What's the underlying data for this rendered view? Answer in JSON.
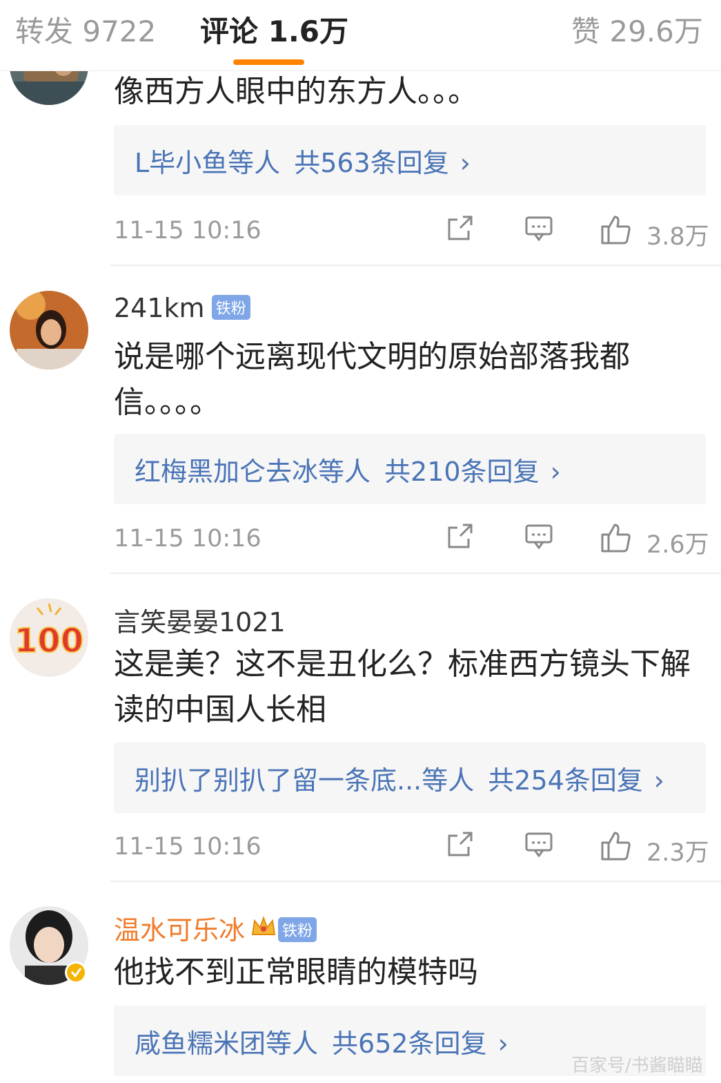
{
  "tabs": {
    "repost_label": "转发 9722",
    "comment_label": "评论 1.6万",
    "like_label": "赞 29.6万"
  },
  "comments": [
    {
      "author": "",
      "text": "像西方人眼中的东方人。。。",
      "reply_users": "L毕小鱼",
      "reply_etc": "等人",
      "reply_count": "共563条回复",
      "time": "11-15 10:16",
      "likes": "3.8万"
    },
    {
      "author": "241km",
      "badge": "铁粉",
      "text": "说是哪个远离现代文明的原始部落我都信。。。。",
      "reply_users": "红梅黑加仑去冰",
      "reply_etc": "等人",
      "reply_count": "共210条回复",
      "time": "11-15 10:16",
      "likes": "2.6万"
    },
    {
      "author": "言笑晏晏1021",
      "text": "这是美？这不是丑化么？标准西方镜头下解读的中国人长相",
      "reply_users": "别扒了别扒了留一条底...",
      "reply_etc": "等人",
      "reply_count": "共254条回复",
      "time": "11-15 10:16",
      "likes": "2.3万"
    },
    {
      "author": "温水可乐冰",
      "badge": "铁粉",
      "text": "他找不到正常眼睛的模特吗",
      "reply_users": "咸鱼糯米团",
      "reply_etc": "等人",
      "reply_count": "共652条回复"
    }
  ],
  "icons": {
    "chevron": "›",
    "avatar3_label": "100"
  },
  "colors": {
    "accent": "#ff8200",
    "link": "#4a74b6",
    "vip_name": "#f07c2b",
    "badge_bg": "#7fa6e6",
    "muted": "#9a9a9a"
  },
  "watermark": "百家号/书酱瞄瞄"
}
